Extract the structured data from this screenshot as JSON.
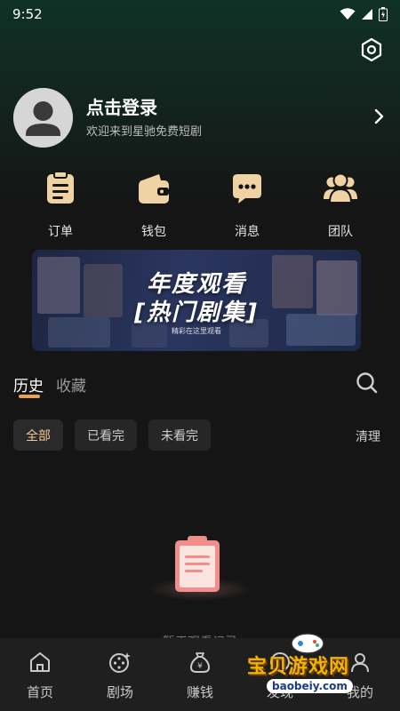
{
  "status_bar": {
    "time": "9:52"
  },
  "profile": {
    "title": "点击登录",
    "subtitle": "欢迎来到星驰免费短剧"
  },
  "quick_actions": [
    {
      "label": "订单",
      "icon": "order-list-icon"
    },
    {
      "label": "钱包",
      "icon": "wallet-icon"
    },
    {
      "label": "消息",
      "icon": "message-icon"
    },
    {
      "label": "团队",
      "icon": "team-icon"
    }
  ],
  "banner": {
    "title_line1": "年度观看",
    "title_line2": "[热门剧集]",
    "subtitle": "精彩在这里观看"
  },
  "tabs": [
    {
      "label": "历史",
      "active": true
    },
    {
      "label": "收藏",
      "active": false
    }
  ],
  "filters": [
    {
      "label": "全部",
      "active": true
    },
    {
      "label": "已看完",
      "active": false
    },
    {
      "label": "未看完",
      "active": false
    }
  ],
  "clear_label": "清理",
  "empty_state": {
    "text": "暂无观看记录"
  },
  "bottom_nav": [
    {
      "label": "首页",
      "icon": "home-icon"
    },
    {
      "label": "剧场",
      "icon": "theater-icon"
    },
    {
      "label": "赚钱",
      "icon": "money-bag-icon"
    },
    {
      "label": "发现",
      "icon": "discover-icon"
    },
    {
      "label": "我的",
      "icon": "user-icon"
    }
  ],
  "watermark": {
    "text": "宝贝游戏网",
    "url": "baobeiy.com"
  },
  "colors": {
    "accent": "#e3a25a",
    "icon_gold": "#f0d3a4",
    "background": "#151515",
    "tabbar": "#1f1f1f"
  }
}
